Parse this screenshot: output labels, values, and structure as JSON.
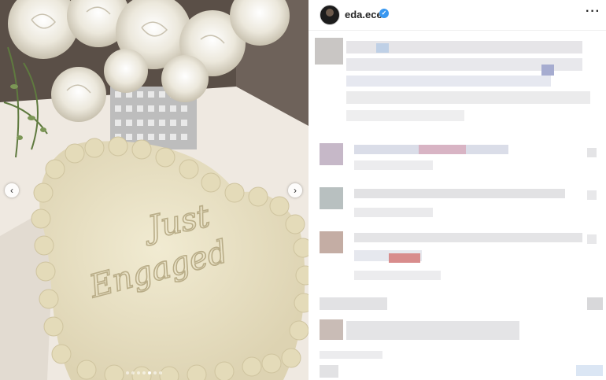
{
  "post": {
    "username": "eda.ece",
    "verified_icon": "verified-badge-icon",
    "more_icon": "more-options-icon",
    "more_glyph": "···"
  },
  "photo": {
    "cake_text_line1": "Just",
    "cake_text_line2": "Engaged",
    "prev_glyph": "‹",
    "next_glyph": "›",
    "slide_count": 7,
    "active_slide": 4
  },
  "colors": {
    "verified": "#3897f0",
    "frosting": "#e9e1c2",
    "table": "#f2ede6"
  }
}
